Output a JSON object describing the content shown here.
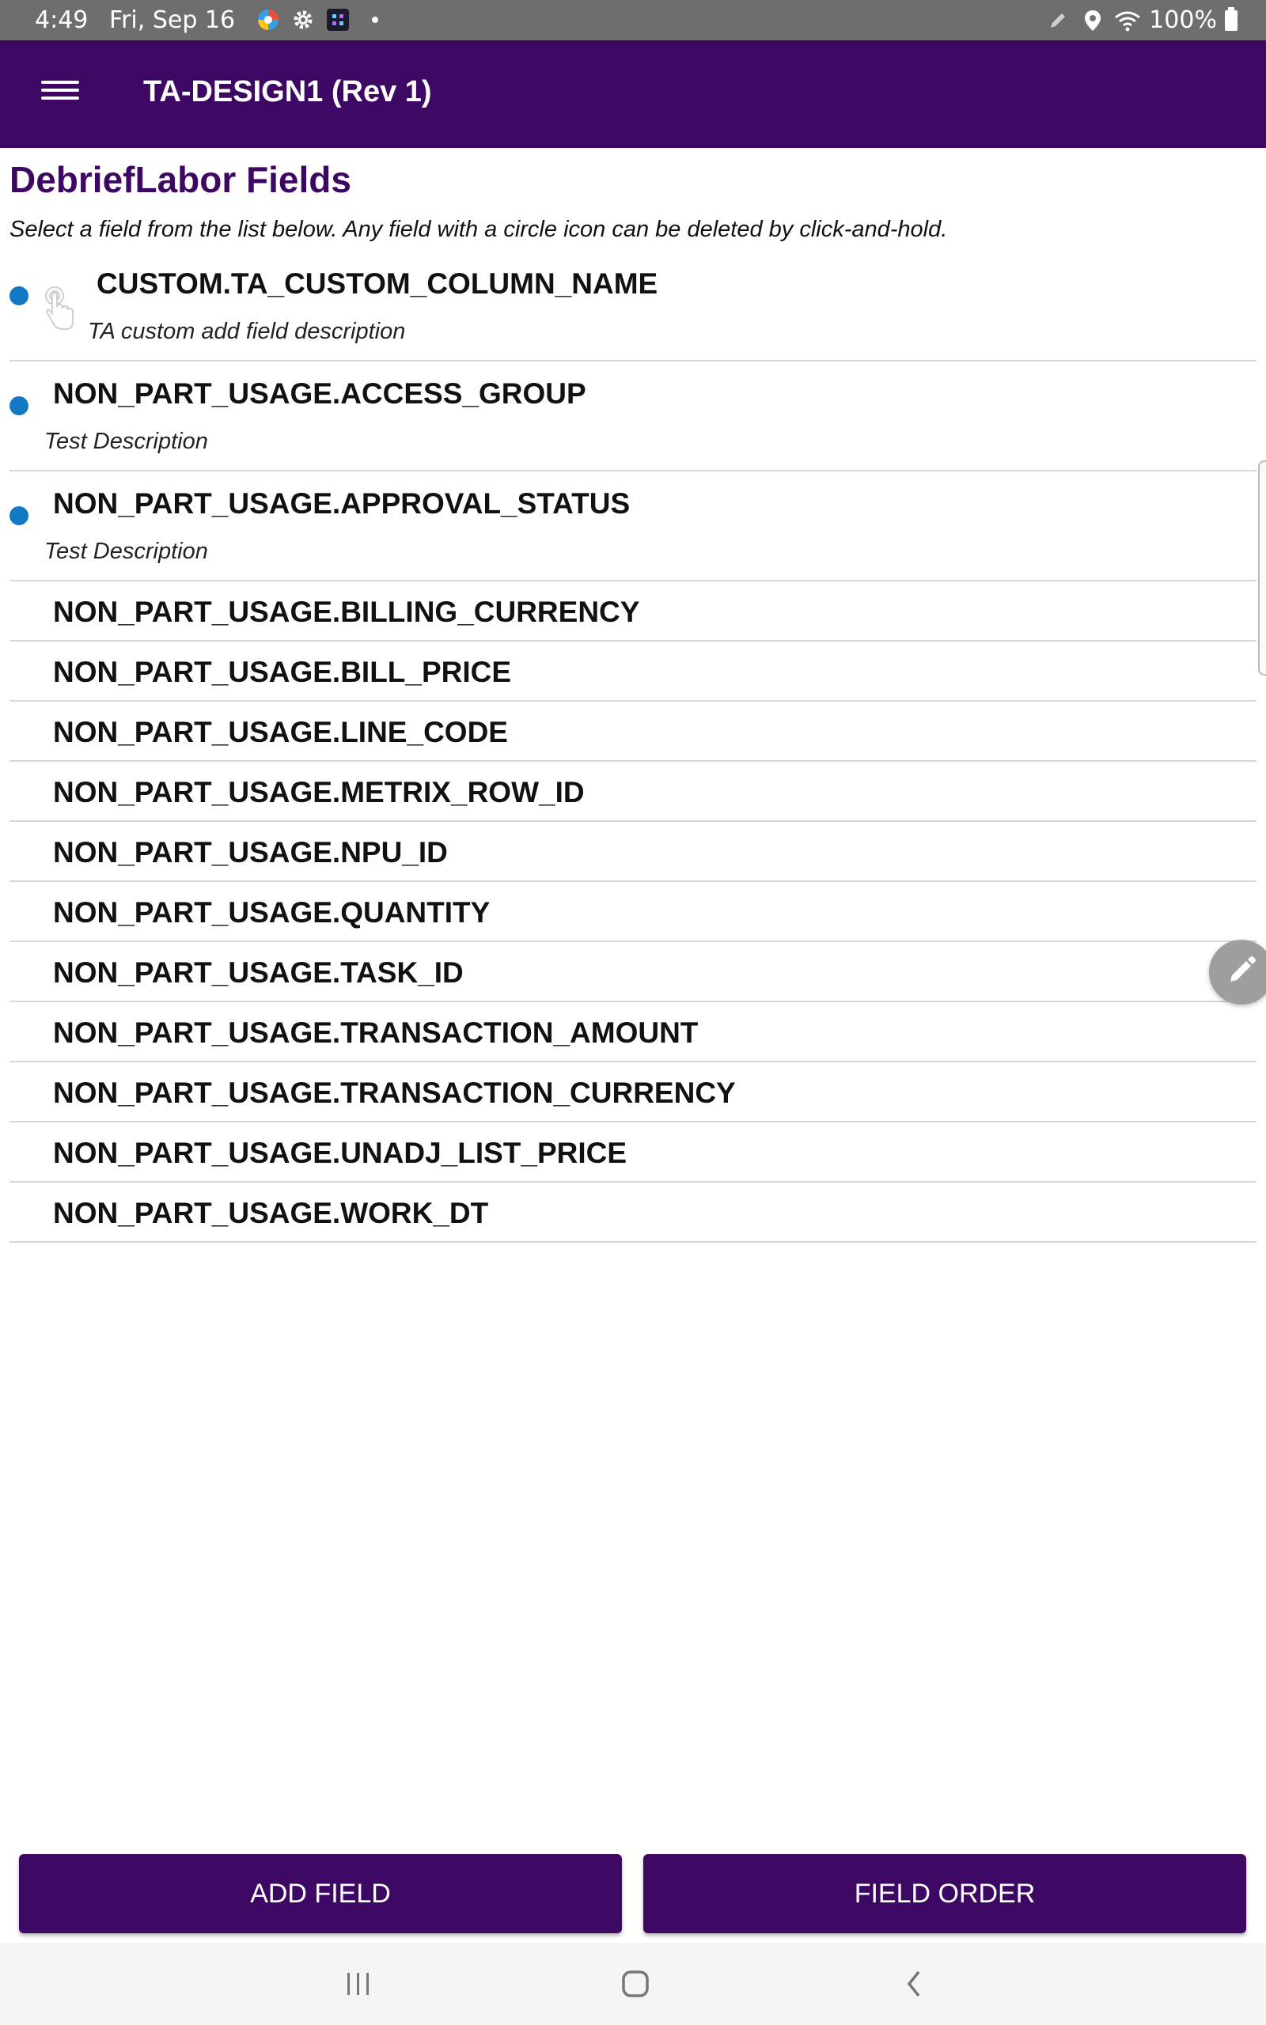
{
  "status_bar": {
    "time": "4:49",
    "date": "Fri, Sep 16",
    "battery": "100%",
    "icons": [
      "browser-icon",
      "settings-gear-icon",
      "app-grid-icon",
      "notification-dot-icon",
      "pen-icon",
      "location-icon",
      "wifi-icon",
      "battery-icon"
    ]
  },
  "app_bar": {
    "title": "TA-DESIGN1 (Rev 1)",
    "menu_icon": "hamburger-menu-icon",
    "color": "#3d0764"
  },
  "page": {
    "title": "DebriefLabor Fields",
    "subtitle": "Select a field from the list below. Any field with a circle icon can be deleted by click-and-hold."
  },
  "fields": [
    {
      "name": "CUSTOM.TA_CUSTOM_COLUMN_NAME",
      "description": "TA custom add field description",
      "deletable": true
    },
    {
      "name": "NON_PART_USAGE.ACCESS_GROUP",
      "description": "Test Description",
      "deletable": true
    },
    {
      "name": "NON_PART_USAGE.APPROVAL_STATUS",
      "description": "Test Description",
      "deletable": true
    },
    {
      "name": "NON_PART_USAGE.BILLING_CURRENCY"
    },
    {
      "name": "NON_PART_USAGE.BILL_PRICE"
    },
    {
      "name": "NON_PART_USAGE.LINE_CODE"
    },
    {
      "name": "NON_PART_USAGE.METRIX_ROW_ID"
    },
    {
      "name": "NON_PART_USAGE.NPU_ID"
    },
    {
      "name": "NON_PART_USAGE.QUANTITY"
    },
    {
      "name": "NON_PART_USAGE.TASK_ID"
    },
    {
      "name": "NON_PART_USAGE.TRANSACTION_AMOUNT"
    },
    {
      "name": "NON_PART_USAGE.TRANSACTION_CURRENCY"
    },
    {
      "name": "NON_PART_USAGE.UNADJ_LIST_PRICE"
    },
    {
      "name": "NON_PART_USAGE.WORK_DT"
    }
  ],
  "buttons": {
    "add_field": "ADD FIELD",
    "field_order": "FIELD ORDER"
  },
  "colors": {
    "primary": "#3d0764",
    "deletable_dot": "#1479c4",
    "fab": "#9e9e9e"
  }
}
